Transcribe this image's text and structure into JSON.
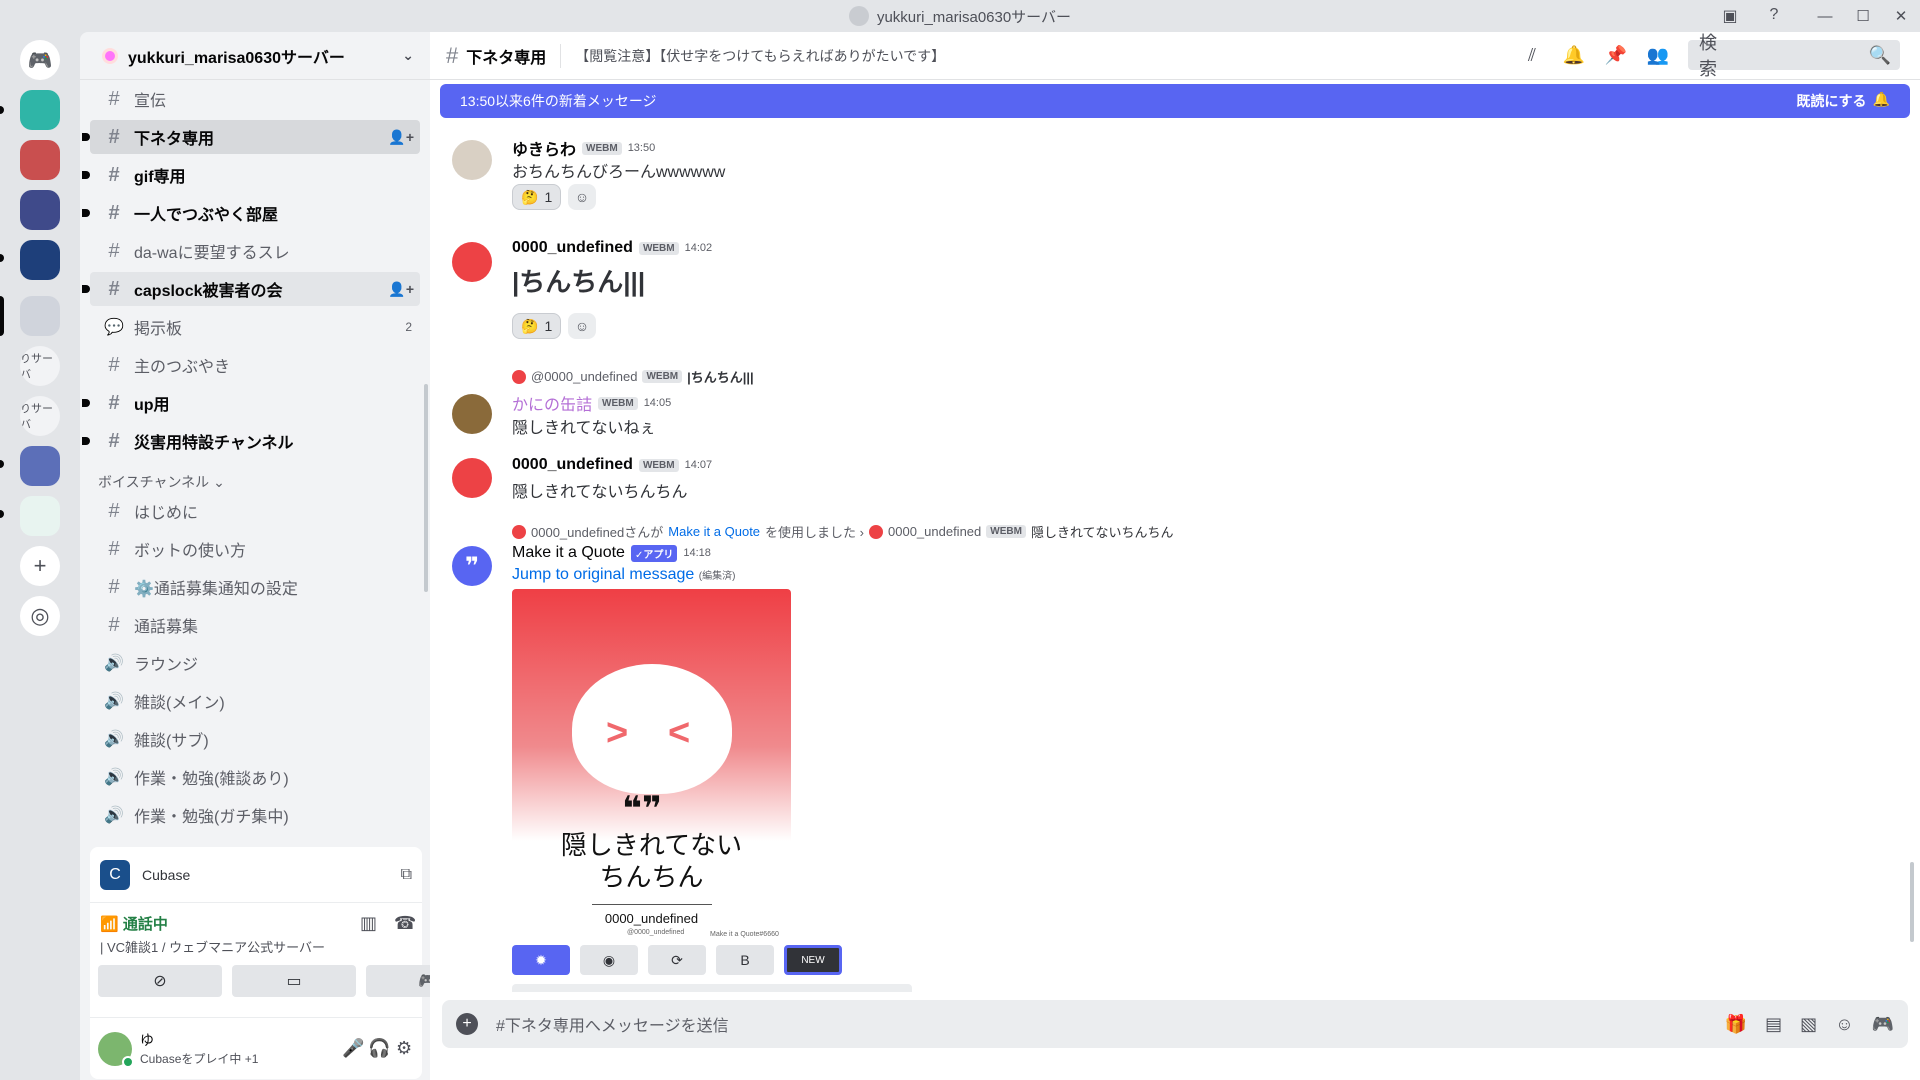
{
  "window": {
    "title": "yukkuri_marisa0630サーバー",
    "controls": {
      "minimize": "—",
      "maximize": "☐",
      "close": "✕"
    }
  },
  "rail": {
    "servers": [
      {
        "name": "sv1",
        "color": "#2fb5a7"
      },
      {
        "name": "sv2",
        "color": "#c94f4f"
      },
      {
        "name": "sv3",
        "color": "#3f4a8a"
      },
      {
        "name": "sv4",
        "color": "#1e3f7a"
      },
      {
        "name": "sv5",
        "color": "#d0d4dc"
      },
      {
        "text": "りサーバ"
      },
      {
        "text": "りサーバ"
      },
      {
        "name": "sv8",
        "color": "#5c6fb8"
      },
      {
        "name": "sv9",
        "color": "#e8f4f0"
      }
    ]
  },
  "sidebar": {
    "server_name": "yukkuri_marisa0630サーバー",
    "channels": [
      {
        "label": "宣伝",
        "type": "text",
        "style": "normal"
      },
      {
        "label": "下ネタ専用",
        "type": "text",
        "style": "active"
      },
      {
        "label": "gif専用",
        "type": "text",
        "style": "bold"
      },
      {
        "label": "一人でつぶやく部屋",
        "type": "text",
        "style": "bold"
      },
      {
        "label": "da-waに要望するスレ",
        "type": "text",
        "style": "normal"
      },
      {
        "label": "capslock被害者の会",
        "type": "text",
        "style": "bold-hl"
      },
      {
        "label": "掲示板",
        "type": "forum",
        "style": "normal",
        "badge": "2"
      },
      {
        "label": "主のつぶやき",
        "type": "text",
        "style": "normal"
      },
      {
        "label": "up用",
        "type": "text",
        "style": "bold"
      },
      {
        "label": "災害用特設チャンネル",
        "type": "text",
        "style": "bold"
      }
    ],
    "voice_category": "ボイスチャンネル",
    "voice_channels": [
      {
        "label": "はじめに",
        "type": "text"
      },
      {
        "label": "ボットの使い方",
        "type": "text"
      },
      {
        "label": "⚙️通話募集通知の設定",
        "type": "text"
      },
      {
        "label": "通話募集",
        "type": "text"
      },
      {
        "label": "ラウンジ",
        "type": "voice"
      },
      {
        "label": "雑談(メイン)",
        "type": "voice"
      },
      {
        "label": "雑談(サブ)",
        "type": "voice"
      },
      {
        "label": "作業・勉強(雑談あり)",
        "type": "voice"
      },
      {
        "label": "作業・勉強(ガチ集中)",
        "type": "voice"
      }
    ]
  },
  "voice_panel": {
    "app_name": "Cubase",
    "status": "通話中",
    "location": "| VC雑談1 / ウェブマニア公式サーバー"
  },
  "user": {
    "name": "ゆ",
    "status": "Cubaseをプレイ中 +1"
  },
  "channel_header": {
    "name": "下ネタ専用",
    "topic": "【閲覧注意】【伏せ字をつけてもらえればありがたいです】",
    "search_placeholder": "検索"
  },
  "new_messages_bar": {
    "text": "13:50以来6件の新着メッセージ",
    "mark_read": "既読にする"
  },
  "messages": [
    {
      "author": "ゆきらわ",
      "tag": "WEBM",
      "time": "13:50",
      "text": "おちんちんびろーんwwwwww",
      "reaction": {
        "emoji": "🤔",
        "count": "1"
      },
      "name_color": "#060607",
      "avatar_color": "#d9d0c4"
    },
    {
      "author": "0000_undefined",
      "tag": "WEBM",
      "time": "14:02",
      "text": "|ちんちん|||",
      "reaction": {
        "emoji": "🤔",
        "count": "1"
      },
      "name_color": "#060607",
      "avatar_color": "#ed4245"
    },
    {
      "reply": {
        "author": "@0000_undefined",
        "tag": "WEBM",
        "text": "|ちんちん|||"
      },
      "author": "かにの缶詰",
      "tag": "WEBM",
      "time": "14:05",
      "text": "隠しきれてないねぇ",
      "name_color": "#b46fd6",
      "avatar_color": "#8a6a3a"
    },
    {
      "author": "0000_undefined",
      "tag": "WEBM",
      "time": "14:07",
      "text": "隠しきれてないちんちん",
      "name_color": "#060607",
      "avatar_color": "#ed4245"
    },
    {
      "reply": {
        "author": "0000_undefinedさんが",
        "app": "Make it a Quote",
        "used": "を使用しました ›",
        "author2": "0000_undefined",
        "tag": "WEBM",
        "text": "隠しきれてないちんちん"
      },
      "author": "Make it a Quote",
      "app_tag": "✓アプリ",
      "time": "14:18",
      "link": "Jump to original message",
      "edited": "(編集済)",
      "name_color": "#060607",
      "avatar_color": "#5865f2"
    }
  ],
  "quote_card": {
    "quote_marks": "❝❞",
    "text_line1": "隠しきれてない",
    "text_line2": "ちんちん",
    "author": "0000_undefined",
    "handle": "@0000_undefined",
    "watermark": "Make it a Quote#6660"
  },
  "quote_buttons": [
    "✹",
    "◉",
    "⟳",
    "B",
    "NEW"
  ],
  "composer": {
    "placeholder": "#下ネタ専用へメッセージを送信"
  }
}
